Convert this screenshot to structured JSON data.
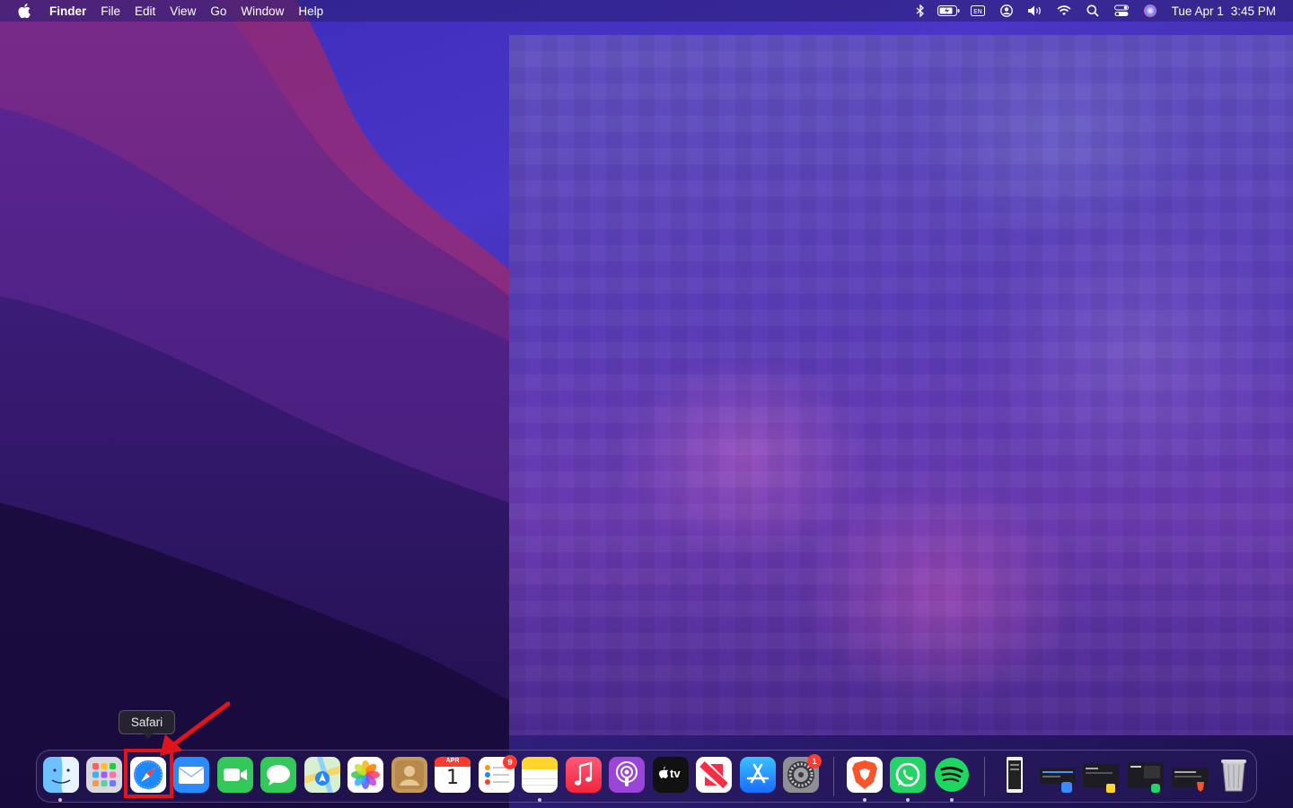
{
  "menubar": {
    "app_name": "Finder",
    "menus": [
      "File",
      "Edit",
      "View",
      "Go",
      "Window",
      "Help"
    ],
    "status_icons": [
      "bluetooth-icon",
      "battery-icon",
      "input-source-icon",
      "user-icon",
      "volume-icon",
      "wifi-icon",
      "spotlight-icon",
      "control-center-icon",
      "siri-icon"
    ],
    "date": "Tue Apr 1",
    "time": "3:45 PM"
  },
  "tooltip": {
    "label": "Safari"
  },
  "dock": {
    "apps": [
      {
        "name": "Finder",
        "icon": "finder-icon",
        "running": true
      },
      {
        "name": "Launchpad",
        "icon": "launchpad-icon",
        "running": false
      },
      {
        "name": "Safari",
        "icon": "safari-icon",
        "running": false
      },
      {
        "name": "Mail",
        "icon": "mail-icon",
        "running": false
      },
      {
        "name": "FaceTime",
        "icon": "facetime-icon",
        "running": false
      },
      {
        "name": "Messages",
        "icon": "messages-icon",
        "running": false
      },
      {
        "name": "Maps",
        "icon": "maps-icon",
        "running": false
      },
      {
        "name": "Photos",
        "icon": "photos-icon",
        "running": false
      },
      {
        "name": "Contacts",
        "icon": "contacts-icon",
        "running": false
      },
      {
        "name": "Calendar",
        "icon": "calendar-icon",
        "running": false,
        "month": "APR",
        "day": "1"
      },
      {
        "name": "Reminders",
        "icon": "reminders-icon",
        "running": false,
        "badge": "9"
      },
      {
        "name": "Notes",
        "icon": "notes-icon",
        "running": true
      },
      {
        "name": "Music",
        "icon": "music-icon",
        "running": false
      },
      {
        "name": "Podcasts",
        "icon": "podcasts-icon",
        "running": false
      },
      {
        "name": "TV",
        "icon": "tv-icon",
        "running": false,
        "label": "tv"
      },
      {
        "name": "News",
        "icon": "news-icon",
        "running": false
      },
      {
        "name": "App Store",
        "icon": "app-store-icon",
        "running": false
      },
      {
        "name": "System Settings",
        "icon": "settings-icon",
        "running": false,
        "badge": "1"
      },
      {
        "name": "Brave",
        "icon": "brave-icon",
        "running": true
      },
      {
        "name": "WhatsApp",
        "icon": "whatsapp-icon",
        "running": true
      },
      {
        "name": "Spotify",
        "icon": "spotify-icon",
        "running": true
      }
    ],
    "recent": [
      "document-icon",
      "window-thumbnail-icon",
      "window-thumbnail-icon",
      "window-thumbnail-icon",
      "window-thumbnail-icon"
    ],
    "trash": "trash-icon"
  },
  "colors": {
    "highlight": "#e0141c",
    "badge": "#ff3b30"
  }
}
